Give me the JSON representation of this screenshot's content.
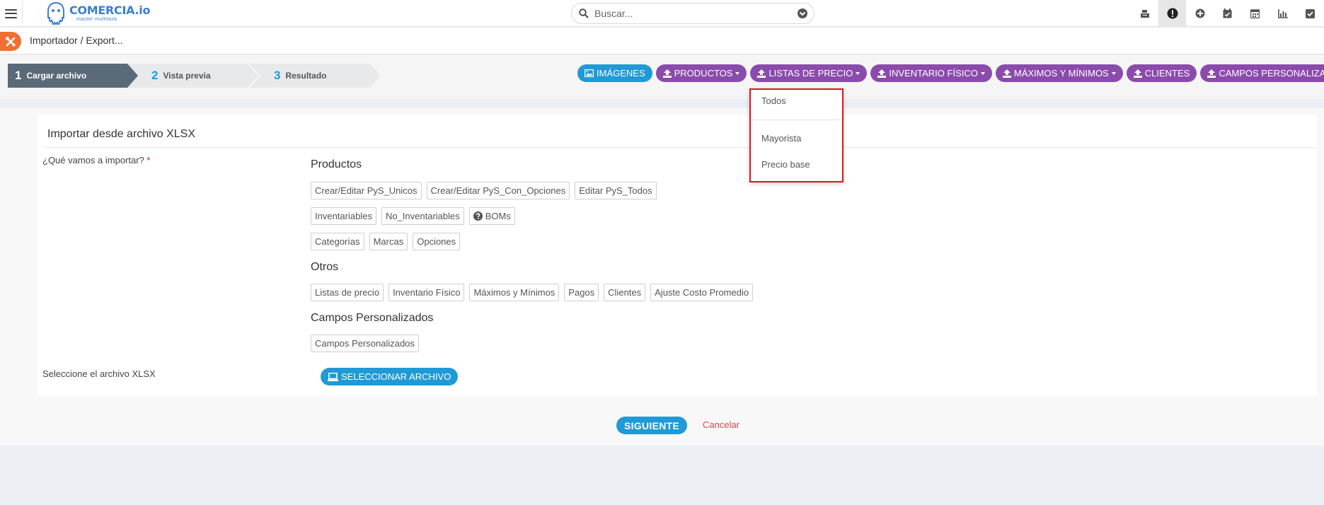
{
  "brand": {
    "name": "COMERCIA.io",
    "tagline": "master multitask",
    "color": "#3a7fd1"
  },
  "search": {
    "placeholder": "Buscar..."
  },
  "top_icons": [
    "cash-register-icon",
    "alert-icon",
    "plus-circle-icon",
    "calendar-check-icon",
    "calendar-icon",
    "bar-chart-icon",
    "checkbox-icon"
  ],
  "breadcrumb": {
    "text": "Importador / Export..."
  },
  "wizard": {
    "steps": [
      {
        "num": "1",
        "label": "Cargar archivo",
        "active": true
      },
      {
        "num": "2",
        "label": "Vista previa",
        "active": false
      },
      {
        "num": "3",
        "label": "Resultado",
        "active": false
      }
    ]
  },
  "toolbar": {
    "imagenes": "IMÁGENES",
    "productos": "PRODUCTOS",
    "listas": "LISTAS DE PRECIO",
    "inventario": "INVENTARIO FÍSICO",
    "maximos": "MÁXIMOS Y MÍNIMOS",
    "clientes": "CLIENTES",
    "campos": "CAMPOS PERSONALIZADOS"
  },
  "dropdown": {
    "items": [
      "Todos",
      "Mayorista",
      "Precio base"
    ]
  },
  "form": {
    "title": "Importar desde archivo XLSX",
    "question_label": "¿Qué vamos a importar?",
    "required_mark": "*",
    "sections": {
      "productos": {
        "title": "Productos",
        "row1": [
          "Crear/Editar PyS_Unicos",
          "Crear/Editar PyS_Con_Opciones",
          "Editar PyS_Todos"
        ],
        "row2": [
          "Inventariables",
          "No_Inventariables",
          "BOMs"
        ],
        "row3": [
          "Categorías",
          "Marcas",
          "Opciones"
        ]
      },
      "otros": {
        "title": "Otros",
        "row1": [
          "Listas de precio",
          "Inventario Físico",
          "Máximos y Mínimos",
          "Pagos",
          "Clientes",
          "Ajuste Costo Promedio"
        ]
      },
      "campos": {
        "title": "Campos Personalizados",
        "row1": [
          "Campos Personalizados"
        ]
      }
    },
    "file_label": "Seleccione el archivo XLSX",
    "file_button": "SELECCIONAR ARCHIVO"
  },
  "actions": {
    "next": "SIGUIENTE",
    "cancel": "Cancelar"
  },
  "colors": {
    "blue": "#1f9ad6",
    "purple": "#8b4bad",
    "step_active": "#5a6a78",
    "highlight_border": "#e0141e"
  }
}
